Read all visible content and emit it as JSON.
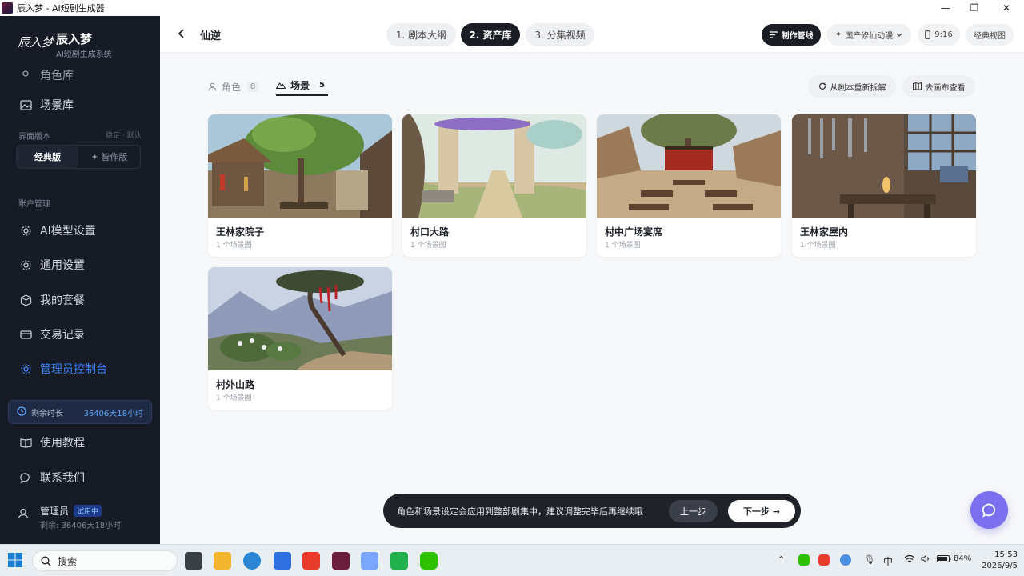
{
  "window": {
    "title": "辰入梦 - AI短剧生成器",
    "controls": [
      "—",
      "❐",
      "✕"
    ]
  },
  "sidebar": {
    "brand_logo": "辰入梦",
    "brand_name": "辰入梦",
    "brand_sub": "AI短剧生成系统",
    "partial_item": "角色库",
    "scene_library": "场景库",
    "ui_version_label": "界面版本",
    "ui_version_hint": "稳定 · 默认",
    "version_classic": "经典版",
    "version_smart": "✦ 智作版",
    "account_label": "账户管理",
    "items": [
      {
        "label": "AI模型设置",
        "icon": "gear-icon"
      },
      {
        "label": "通用设置",
        "icon": "gear-icon"
      },
      {
        "label": "我的套餐",
        "icon": "package-icon"
      },
      {
        "label": "交易记录",
        "icon": "card-icon"
      },
      {
        "label": "管理员控制台",
        "icon": "gear-icon"
      }
    ],
    "remain_label": "剩余时长",
    "remain_value": "36406天18小时",
    "tutorial": "使用教程",
    "contact": "联系我们",
    "user_name": "管理员",
    "user_badge": "试用中",
    "user_remain": "剩余: 36406天18小时"
  },
  "topbar": {
    "title": "仙逆",
    "steps": [
      "1. 剧本大纲",
      "2. 资产库",
      "3. 分集视频"
    ],
    "pipeline": "制作管线",
    "style": "国产修仙动漫",
    "ratio": "9:16",
    "classic_view": "经典视图"
  },
  "tabs": {
    "role_label": "角色",
    "role_count": "8",
    "scene_label": "场景",
    "scene_count": "5"
  },
  "actions": {
    "resplit": "从剧本重新拆解",
    "canvas": "去画布查看"
  },
  "scenes": [
    {
      "title": "王林家院子",
      "sub": "1 个场景图"
    },
    {
      "title": "村口大路",
      "sub": "1 个场景图"
    },
    {
      "title": "村中广场宴席",
      "sub": "1 个场景图"
    },
    {
      "title": "王林家屋内",
      "sub": "1 个场景图"
    },
    {
      "title": "村外山路",
      "sub": "1 个场景图"
    }
  ],
  "bottom": {
    "message": "角色和场景设定会应用到整部剧集中，建议调整完毕后再继续哦",
    "prev": "上一步",
    "next": "下一步 →"
  },
  "taskbar": {
    "search": "搜索",
    "tray_lang": "中",
    "battery": "84%",
    "time": "15:53",
    "date": "2026/9/5"
  }
}
